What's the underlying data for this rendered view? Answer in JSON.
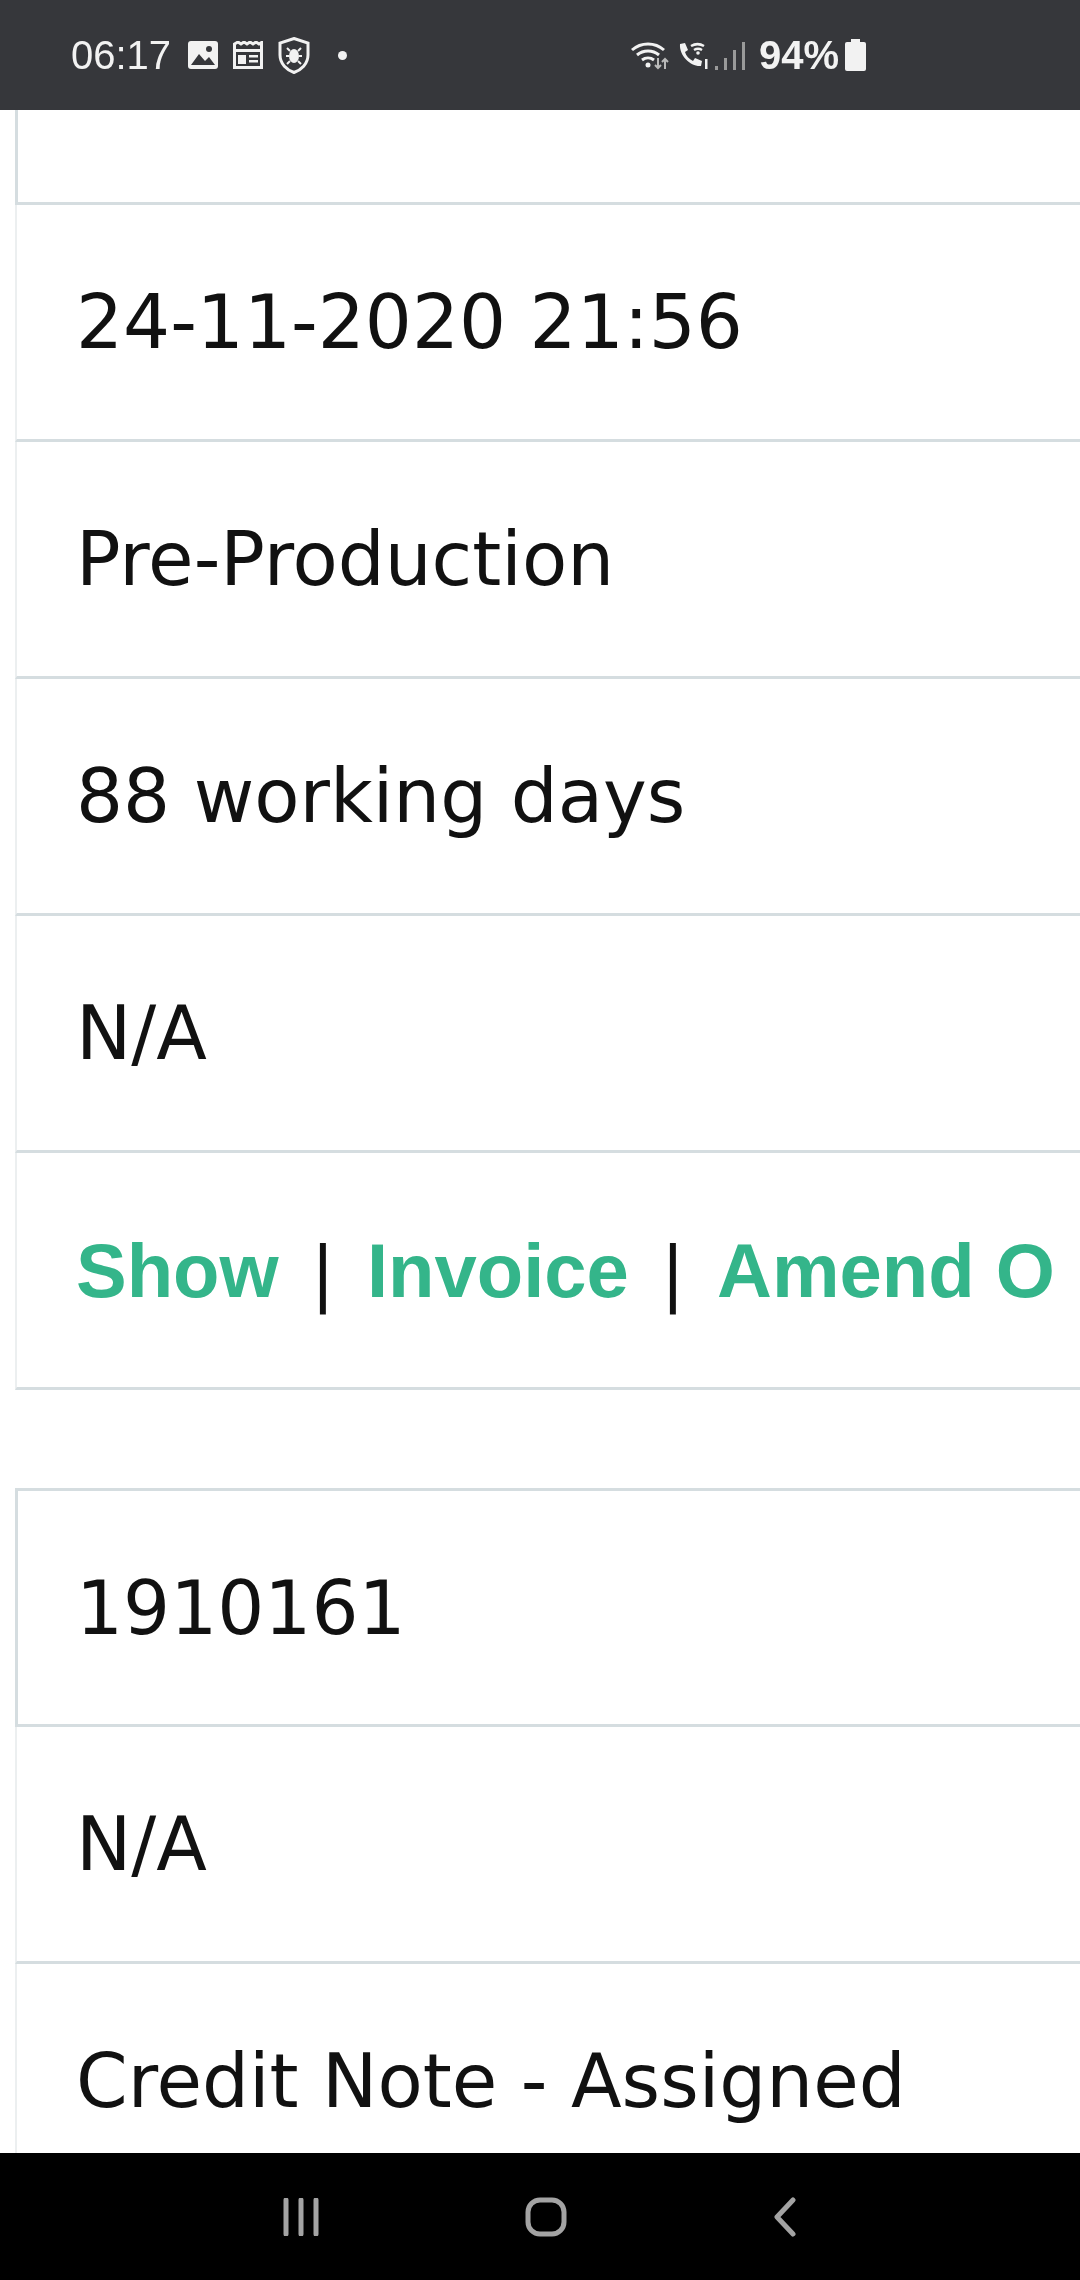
{
  "status_bar": {
    "time": "06:17",
    "battery": "94%"
  },
  "records": [
    {
      "fields": [
        "24-11-2020 21:56",
        "Pre-Production",
        "88 working days",
        "N/A"
      ],
      "actions": [
        {
          "kind": "link",
          "text": "Show"
        },
        {
          "kind": "separator",
          "text": "|"
        },
        {
          "kind": "link",
          "text": "Invoice"
        },
        {
          "kind": "separator",
          "text": "|"
        },
        {
          "kind": "link",
          "text": "Amend O"
        }
      ]
    },
    {
      "number": "1910161",
      "fields": [
        "N/A",
        "Credit Note - Assigned"
      ]
    }
  ]
}
